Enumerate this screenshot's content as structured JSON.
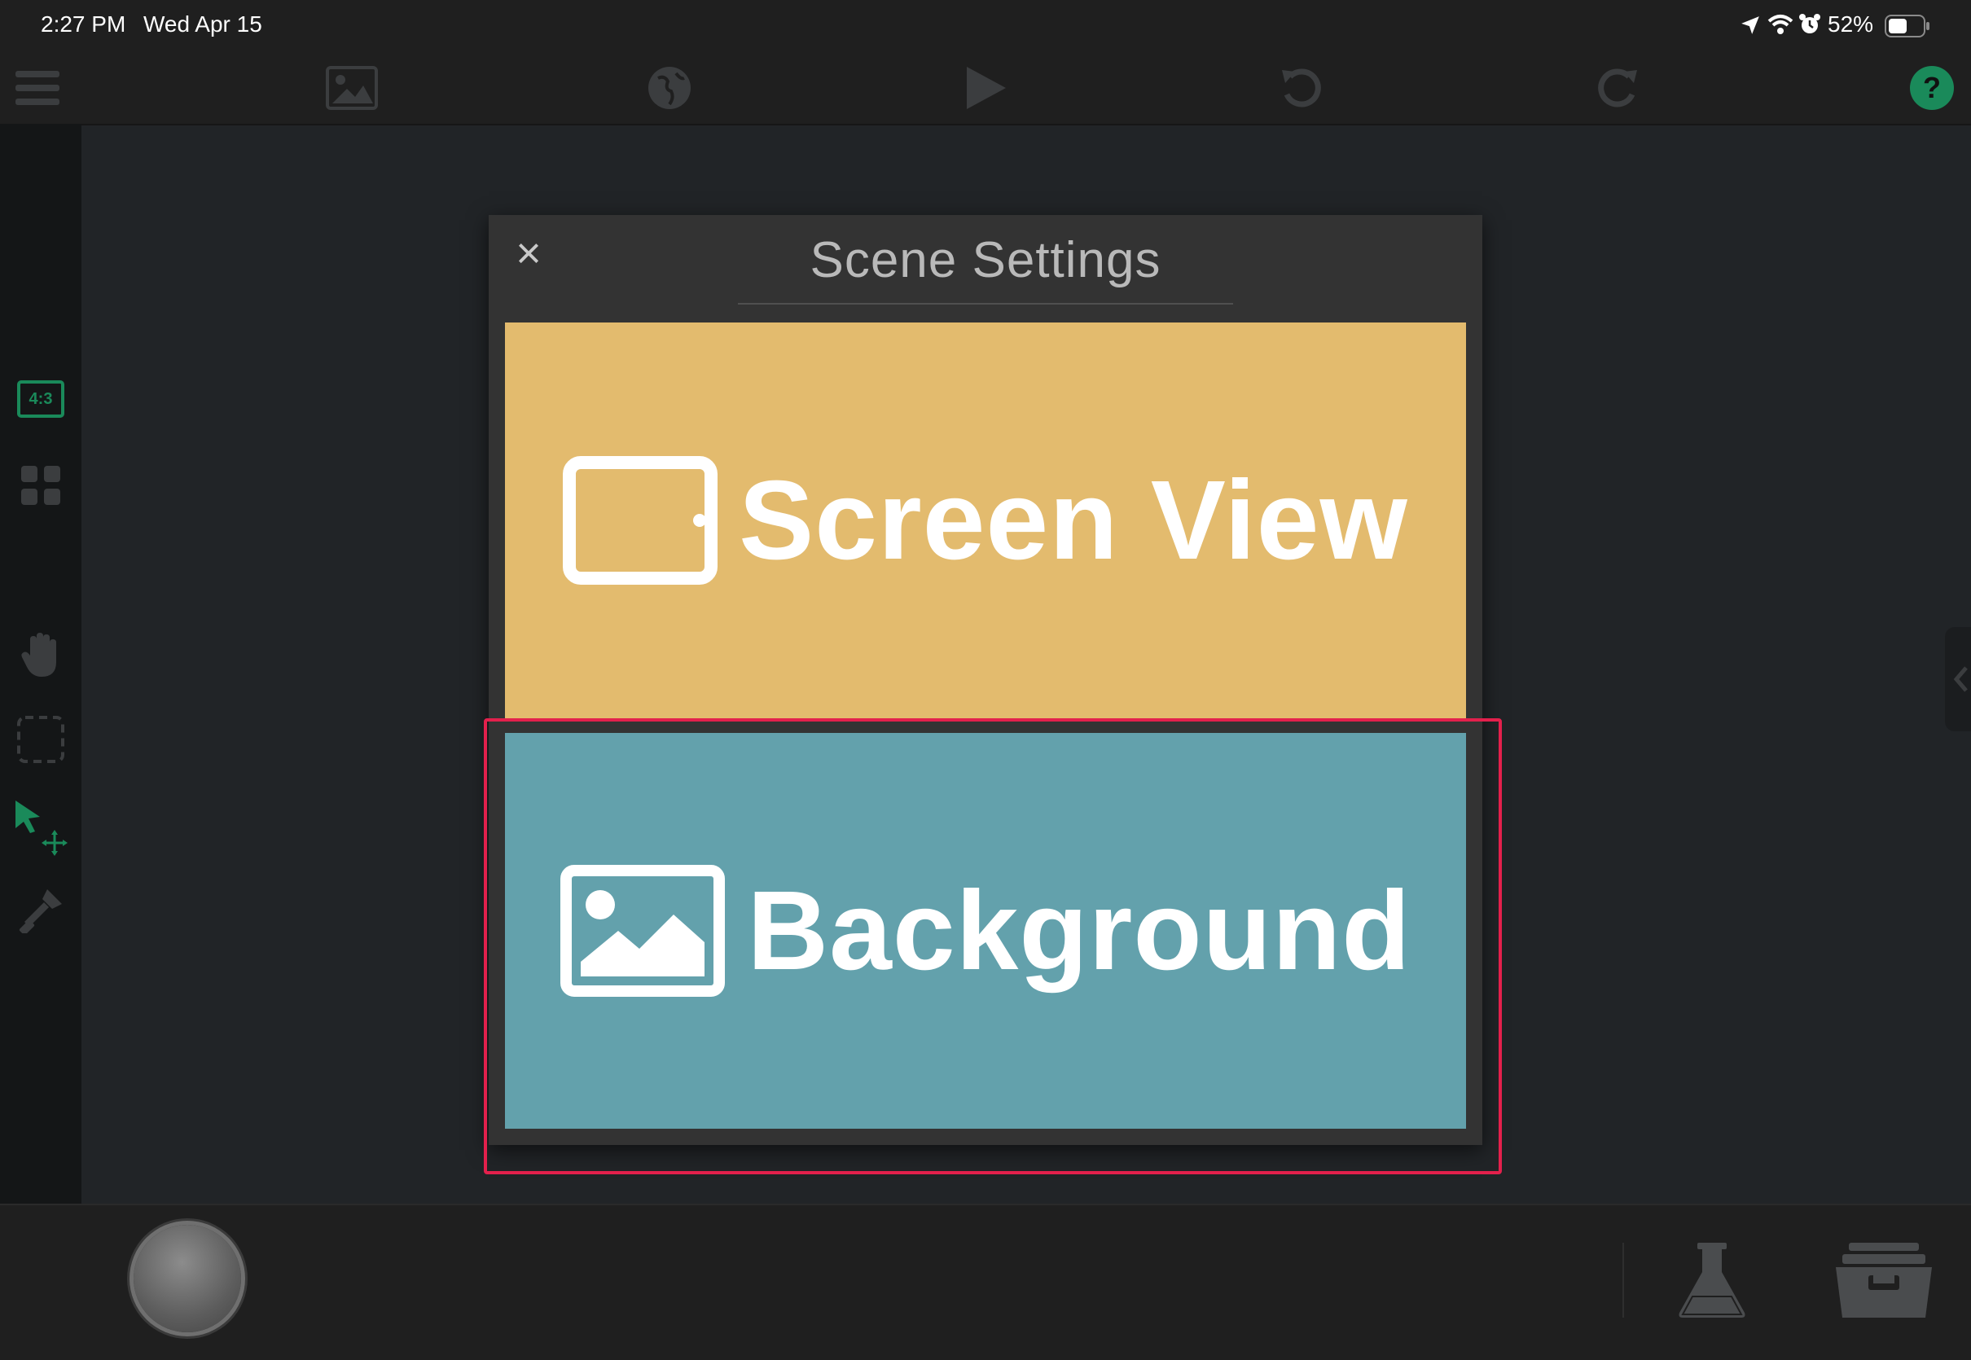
{
  "status_bar": {
    "time": "2:27 PM",
    "date": "Wed Apr 15",
    "battery": "52%"
  },
  "toolbar": {
    "icons": [
      "menu-icon",
      "image-icon",
      "globe-icon",
      "play-icon",
      "undo-icon",
      "redo-icon",
      "help-icon"
    ]
  },
  "sidebar": {
    "aspect_label": "4:3",
    "icons": [
      "aspect-ratio-icon",
      "grid-icon",
      "hand-icon",
      "selection-icon",
      "move-cursor-icon",
      "stamp-icon"
    ]
  },
  "modal": {
    "title": "Scene Settings",
    "close": "×",
    "options": [
      {
        "label": "Screen View",
        "icon": "tablet-icon",
        "color": "#e3bb6e"
      },
      {
        "label": "Background",
        "icon": "image-icon",
        "color": "#63a1ac"
      }
    ]
  },
  "colors": {
    "accent_green": "#1a8a5a",
    "highlight_red": "#e3204c"
  }
}
